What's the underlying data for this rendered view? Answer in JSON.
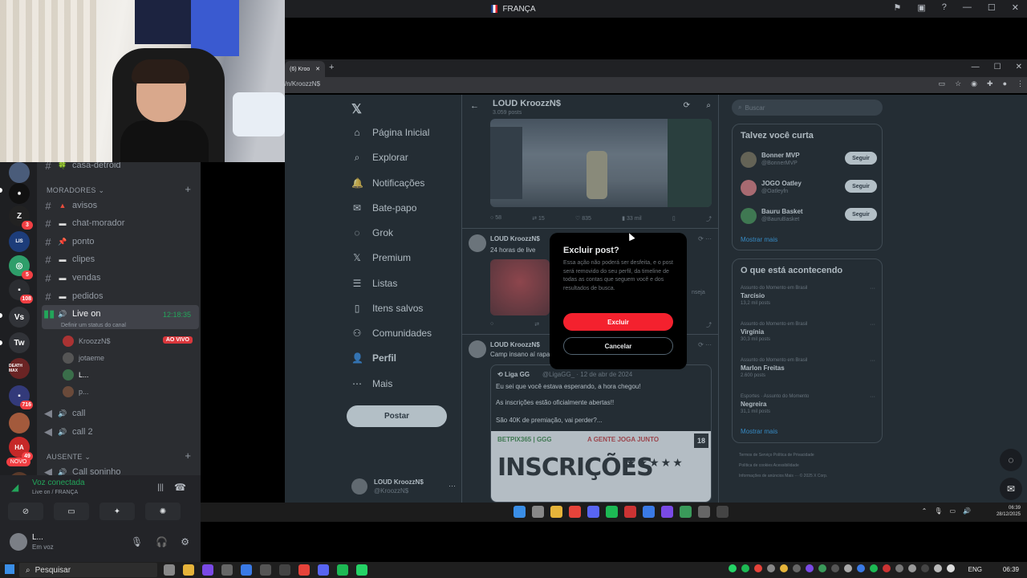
{
  "discord_top": {
    "title": "FRANÇA"
  },
  "channels": {
    "top_channel": "casa-detroid",
    "category_moradores": "MORADORES",
    "text_channels": [
      "avisos",
      "chat-morador",
      "ponto",
      "clipes",
      "vendas",
      "pedidos"
    ],
    "active_voice": {
      "name": "Live on",
      "time": "12:18:35",
      "status_hint": "Definir um status do canal"
    },
    "voice_users": [
      {
        "name": "KroozzN$",
        "badge": "AO VIVO"
      },
      {
        "name": "jotaeme"
      },
      {
        "name": "L..."
      },
      {
        "name": "p..."
      }
    ],
    "other_voice": [
      "call",
      "call 2"
    ],
    "category_ausente": "AUSENTE",
    "ausente_first": "Call soninho"
  },
  "guild_badges": [
    "3",
    "5",
    "108",
    "716",
    "49",
    "NOVO"
  ],
  "guild_labels": [
    "Vs",
    "Tw",
    "DEATH MAX",
    "HA"
  ],
  "voice_panel": {
    "status": "Voz conectada",
    "sub": "Live on / FRANÇA"
  },
  "user_panel": {
    "name": "L...",
    "status": "Em voz"
  },
  "chrome": {
    "tab_title": "(6) Kroo",
    "url": "/n/KroozzN$"
  },
  "x": {
    "nav": [
      "Página Inicial",
      "Explorar",
      "Notificações",
      "Bate-papo",
      "Grok",
      "Premium",
      "Listas",
      "Itens salvos",
      "Comunidades",
      "Perfil",
      "Mais"
    ],
    "post_button": "Postar",
    "account": {
      "name": "LOUD KroozzN$",
      "handle": "@KroozzN$"
    },
    "profile_header": {
      "name": "LOUD KroozzN$",
      "post_count": "3.059 posts"
    },
    "tweet1_actions": [
      "58",
      "15",
      "835",
      "33 mil"
    ],
    "tweet2": {
      "name": "LOUD KroozzN$",
      "text": "24 horas de live",
      "side_text": "nseja"
    },
    "tweet3": {
      "name": "LOUD KroozzN$",
      "text": "Camp insano aí rapa"
    },
    "quote": {
      "name": "Liga GG",
      "handle": "@LigaGG_ · 12 de abr de 2024",
      "lines": [
        "Eu sei que você estava esperando, a hora chegou!",
        "As inscrições estão oficialmente abertas!!",
        "São 40K de premiação, vai perder?..."
      ],
      "promo_brand": "BETPIX365",
      "promo_partner": "GGG",
      "promo_tag": "A GENTE JOGA JUNTO",
      "promo_age": "18",
      "promo_big": "INSCRIÇÕES",
      "promo_stars": "★★★★★"
    },
    "search_placeholder": "Buscar",
    "who_to_follow": {
      "title": "Talvez você curta",
      "items": [
        {
          "name": "Bonner MVP",
          "handle": "@BonnerMVP",
          "button": "Seguir"
        },
        {
          "name": "JOGO Oatley",
          "handle": "@Oatleyfn",
          "button": "Seguir"
        },
        {
          "name": "Bauru Basket",
          "handle": "@BauruBasket",
          "button": "Seguir"
        }
      ],
      "more": "Mostrar mais"
    },
    "trends": {
      "title": "O que está acontecendo",
      "items": [
        {
          "context": "Assunto do Momento em Brasil",
          "topic": "Tarcísio",
          "count": "13,2 mil posts"
        },
        {
          "context": "Assunto do Momento em Brasil",
          "topic": "Virgínia",
          "count": "30,3 mil posts"
        },
        {
          "context": "Assunto do Momento em Brasil",
          "topic": "Marlon Freitas",
          "count": "2.600 posts"
        },
        {
          "context": "Esportes · Assunto do Momento",
          "topic": "Negreira",
          "count": "31,1 mil posts"
        }
      ],
      "more": "Mostrar mais"
    },
    "footer": {
      "line1": "Termos de Serviço   Política de Privacidade",
      "line2": "Política de cookies   Acessibilidade",
      "line3": "Informações de anúncios   Mais ···   © 2025 X Corp."
    },
    "modal": {
      "title": "Excluir post?",
      "body": "Essa ação não poderá ser desfeita, e o post será removido do seu perfil, da timeline de todas as contas que seguem você e dos resultados de busca.",
      "confirm": "Excluir",
      "cancel": "Cancelar"
    }
  },
  "inner_clock": {
    "time": "06:39",
    "date": "28/12/2025"
  },
  "taskbar": {
    "search_label": "Pesquisar",
    "lang": "ENG",
    "time": "06:39"
  }
}
